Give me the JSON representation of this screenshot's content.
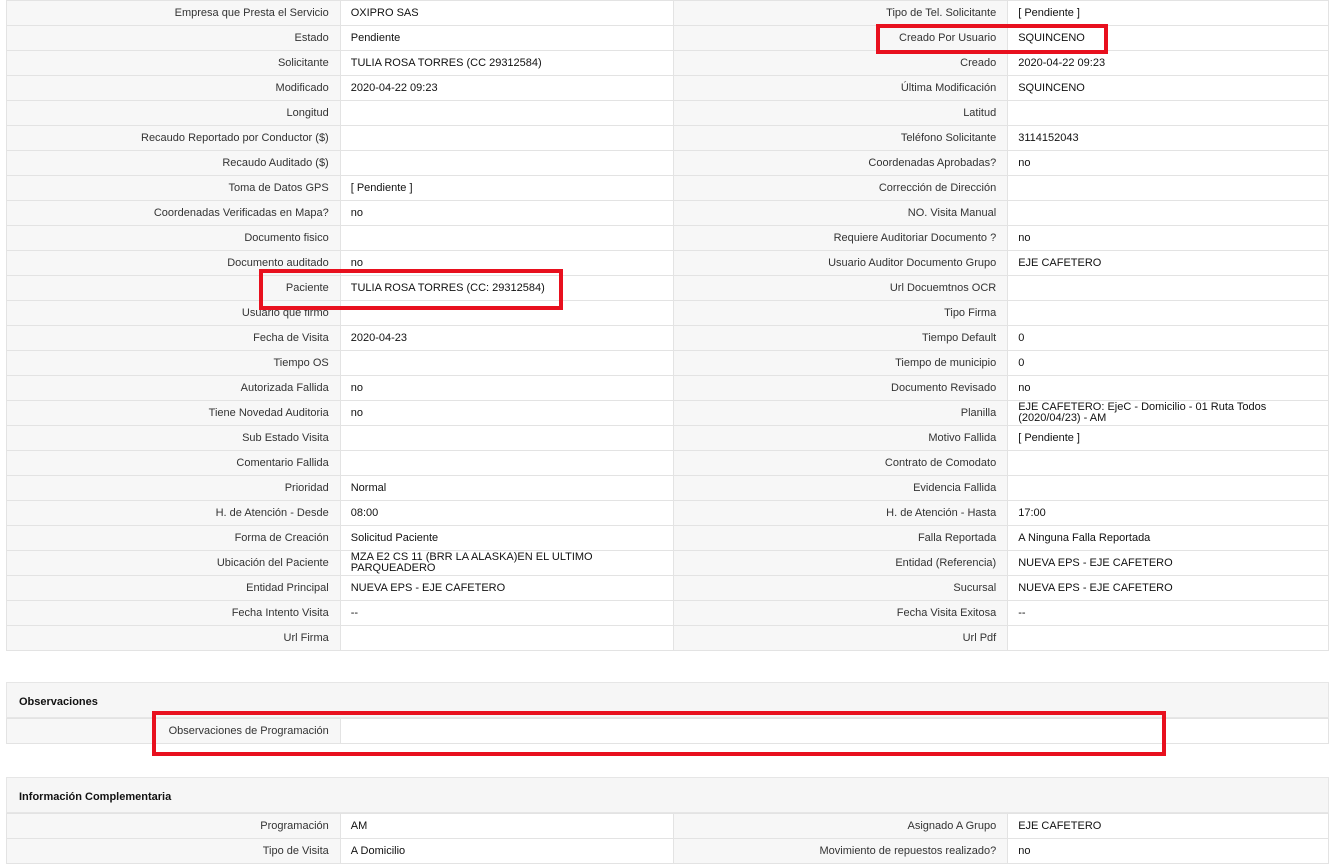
{
  "main_details": [
    {
      "l1": "Empresa que Presta el Servicio",
      "v1": "OXIPRO SAS",
      "l2": "Tipo de Tel. Solicitante",
      "v2": "[ Pendiente ]"
    },
    {
      "l1": "Estado",
      "v1": "Pendiente",
      "l2": "Creado Por Usuario",
      "v2": "SQUINCENO"
    },
    {
      "l1": "Solicitante",
      "v1": "TULIA ROSA TORRES (CC 29312584)",
      "l2": "Creado",
      "v2": "2020-04-22 09:23"
    },
    {
      "l1": "Modificado",
      "v1": "2020-04-22 09:23",
      "l2": "Última Modificación",
      "v2": " SQUINCENO"
    },
    {
      "l1": "Longitud",
      "v1": "",
      "l2": "Latitud",
      "v2": ""
    },
    {
      "l1": "Recaudo Reportado por Conductor ($)",
      "v1": "",
      "l2": "Teléfono Solicitante",
      "v2": "3114152043"
    },
    {
      "l1": "Recaudo Auditado ($)",
      "v1": "",
      "l2": "Coordenadas Aprobadas?",
      "v2": " no"
    },
    {
      "l1": "Toma de Datos GPS",
      "v1": "[ Pendiente ]",
      "l2": "Corrección de Dirección",
      "v2": ""
    },
    {
      "l1": "Coordenadas Verificadas en Mapa?",
      "v1": " no",
      "l2": "NO. Visita Manual",
      "v2": ""
    },
    {
      "l1": "Documento fisico",
      "v1": "",
      "l2": "Requiere Auditoriar Documento ?",
      "v2": " no"
    },
    {
      "l1": "Documento auditado",
      "v1": "no",
      "l2": "Usuario Auditor Documento Grupo",
      "v2": "EJE CAFETERO"
    },
    {
      "l1": "Paciente",
      "v1": "TULIA ROSA TORRES (CC: 29312584)",
      "l2": "Url Docuemtnos OCR",
      "v2": ""
    },
    {
      "l1": "Usuario que firmo",
      "v1": "",
      "l2": "Tipo Firma",
      "v2": ""
    },
    {
      "l1": "Fecha de Visita",
      "v1": " 2020-04-23",
      "l2": "Tiempo Default",
      "v2": "0"
    },
    {
      "l1": "Tiempo OS",
      "v1": "",
      "l2": "Tiempo de municipio",
      "v2": "0"
    },
    {
      "l1": "Autorizada Fallida",
      "v1": "no",
      "l2": "Documento Revisado",
      "v2": " no"
    },
    {
      "l1": "Tiene Novedad Auditoria",
      "v1": "no",
      "l2": "Planilla",
      "v2": "EJE CAFETERO: EjeC - Domicilio - 01 Ruta Todos (2020/04/23) - AM"
    },
    {
      "l1": "Sub Estado Visita",
      "v1": "",
      "l2": "Motivo Fallida",
      "v2": "[ Pendiente ]"
    },
    {
      "l1": "Comentario Fallida",
      "v1": "",
      "l2": "Contrato de Comodato",
      "v2": ""
    },
    {
      "l1": "Prioridad",
      "v1": "Normal",
      "l2": "Evidencia Fallida",
      "v2": ""
    },
    {
      "l1": "H. de Atención - Desde",
      "v1": "08:00",
      "l2": "H. de Atención - Hasta",
      "v2": "17:00"
    },
    {
      "l1": "Forma de Creación",
      "v1": "Solicitud Paciente",
      "l2": "Falla Reportada",
      "v2": "A Ninguna Falla Reportada"
    },
    {
      "l1": "Ubicación del Paciente",
      "v1": "MZA E2 CS 11 (BRR LA ALASKA)EN EL ULTIMO PARQUEADERO",
      "l2": "Entidad (Referencia)",
      "v2": "NUEVA EPS - EJE CAFETERO"
    },
    {
      "l1": "Entidad Principal",
      "v1": "NUEVA EPS - EJE CAFETERO",
      "l2": "Sucursal",
      "v2": "NUEVA EPS - EJE CAFETERO"
    },
    {
      "l1": "Fecha Intento Visita",
      "v1": " --",
      "l2": "Fecha Visita Exitosa",
      "v2": " --"
    },
    {
      "l1": "Url Firma",
      "v1": "",
      "l2": "Url Pdf",
      "v2": ""
    }
  ],
  "observaciones": {
    "title": "Observaciones",
    "label": "Observaciones de Programación",
    "value": ""
  },
  "complementaria": {
    "title": "Información Complementaria",
    "rows": [
      {
        "l1": "Programación",
        "v1": "AM",
        "l2": "Asignado A Grupo",
        "v2": "EJE CAFETERO"
      },
      {
        "l1": "Tipo de Visita",
        "v1": "A Domicilio",
        "l2": "Movimiento de repuestos realizado?",
        "v2": " no"
      }
    ]
  },
  "highlight_color": "#e8101e"
}
